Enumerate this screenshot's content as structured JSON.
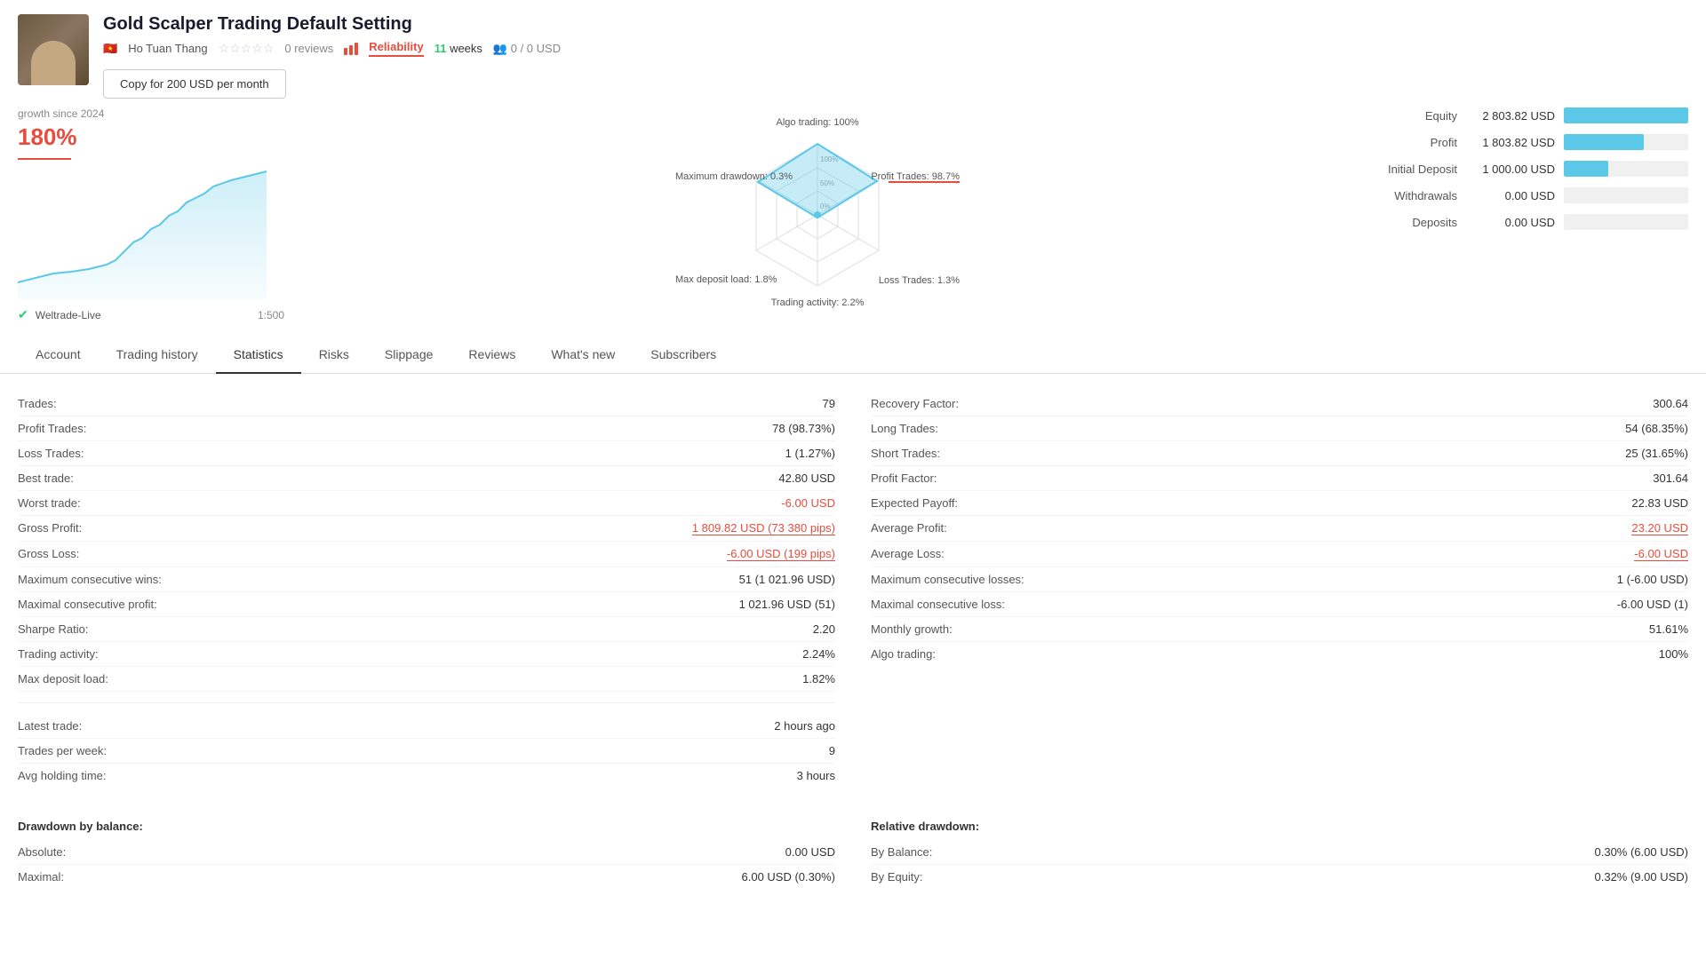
{
  "header": {
    "title": "Gold Scalper Trading Default Setting",
    "author": "Ho Tuan Thang",
    "stars": "★★★★★",
    "reviews": "0 reviews",
    "reliability_label": "Reliability",
    "weeks_num": "11",
    "weeks_label": "weeks",
    "users": "0 / 0 USD",
    "copy_button": "Copy for 200 USD per month"
  },
  "growth": {
    "label": "growth since 2024",
    "value": "180%"
  },
  "broker": {
    "name": "Weltrade-Live",
    "leverage": "1:500"
  },
  "radar": {
    "algo_trading": "Algo trading: 100%",
    "max_drawdown": "Maximum drawdown: 0.3%",
    "profit_trades": "Profit Trades: 98.7%",
    "max_deposit_load": "Max deposit load: 1.8%",
    "loss_trades": "Loss Trades: 1.3%",
    "trading_activity": "Trading activity: 2.2%"
  },
  "equity_stats": {
    "equity_label": "Equity",
    "equity_value": "2 803.82 USD",
    "equity_pct": 100,
    "profit_label": "Profit",
    "profit_value": "1 803.82 USD",
    "profit_pct": 64,
    "initial_label": "Initial Deposit",
    "initial_value": "1 000.00 USD",
    "initial_pct": 36,
    "withdrawals_label": "Withdrawals",
    "withdrawals_value": "0.00 USD",
    "deposits_label": "Deposits",
    "deposits_value": "0.00 USD"
  },
  "tabs": [
    {
      "label": "Account",
      "active": false
    },
    {
      "label": "Trading history",
      "active": false
    },
    {
      "label": "Statistics",
      "active": true
    },
    {
      "label": "Risks",
      "active": false
    },
    {
      "label": "Slippage",
      "active": false
    },
    {
      "label": "Reviews",
      "active": false
    },
    {
      "label": "What's new",
      "active": false
    },
    {
      "label": "Subscribers",
      "active": false
    }
  ],
  "statistics_left": {
    "trades_label": "Trades:",
    "trades_value": "79",
    "profit_trades_label": "Profit Trades:",
    "profit_trades_value": "78 (98.73%)",
    "loss_trades_label": "Loss Trades:",
    "loss_trades_value": "1 (1.27%)",
    "best_trade_label": "Best trade:",
    "best_trade_value": "42.80 USD",
    "worst_trade_label": "Worst trade:",
    "worst_trade_value": "-6.00 USD",
    "gross_profit_label": "Gross Profit:",
    "gross_profit_value": "1 809.82 USD (73 380 pips)",
    "gross_loss_label": "Gross Loss:",
    "gross_loss_value": "-6.00 USD (199 pips)",
    "max_consec_wins_label": "Maximum consecutive wins:",
    "max_consec_wins_value": "51 (1 021.96 USD)",
    "max_consec_profit_label": "Maximal consecutive profit:",
    "max_consec_profit_value": "1 021.96 USD (51)",
    "sharpe_ratio_label": "Sharpe Ratio:",
    "sharpe_ratio_value": "2.20",
    "trading_activity_label": "Trading activity:",
    "trading_activity_value": "2.24%",
    "max_deposit_load_label": "Max deposit load:",
    "max_deposit_load_value": "1.82%",
    "latest_trade_label": "Latest trade:",
    "latest_trade_value": "2 hours ago",
    "trades_per_week_label": "Trades per week:",
    "trades_per_week_value": "9",
    "avg_holding_label": "Avg holding time:",
    "avg_holding_value": "3 hours"
  },
  "statistics_right": {
    "recovery_factor_label": "Recovery Factor:",
    "recovery_factor_value": "300.64",
    "long_trades_label": "Long Trades:",
    "long_trades_value": "54 (68.35%)",
    "short_trades_label": "Short Trades:",
    "short_trades_value": "25 (31.65%)",
    "profit_factor_label": "Profit Factor:",
    "profit_factor_value": "301.64",
    "expected_payoff_label": "Expected Payoff:",
    "expected_payoff_value": "22.83 USD",
    "avg_profit_label": "Average Profit:",
    "avg_profit_value": "23.20 USD",
    "avg_loss_label": "Average Loss:",
    "avg_loss_value": "-6.00 USD",
    "max_consec_losses_label": "Maximum consecutive losses:",
    "max_consec_losses_value": "1 (-6.00 USD)",
    "max_consec_loss_label": "Maximal consecutive loss:",
    "max_consec_loss_value": "-6.00 USD (1)",
    "monthly_growth_label": "Monthly growth:",
    "monthly_growth_value": "51.61%",
    "algo_trading_label": "Algo trading:",
    "algo_trading_value": "100%"
  },
  "drawdown_left": {
    "title": "Drawdown by balance:",
    "absolute_label": "Absolute:",
    "absolute_value": "0.00 USD",
    "maximal_label": "Maximal:",
    "maximal_value": "6.00 USD (0.30%)"
  },
  "drawdown_right": {
    "title": "Relative drawdown:",
    "by_balance_label": "By Balance:",
    "by_balance_value": "0.30% (6.00 USD)",
    "by_equity_label": "By Equity:",
    "by_equity_value": "0.32% (9.00 USD)"
  }
}
